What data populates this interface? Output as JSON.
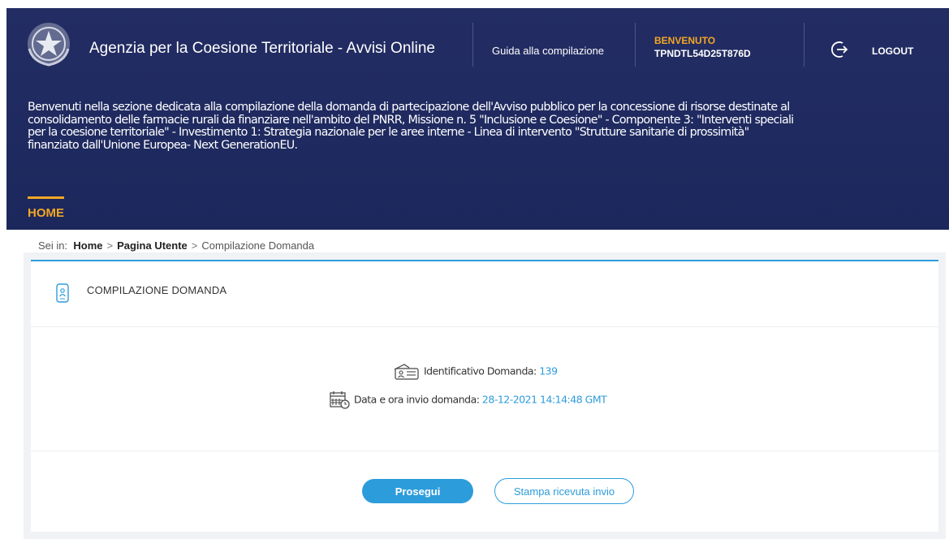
{
  "header": {
    "app_title": "Agenzia per la Coesione Territoriale - Avvisi Online",
    "guide_link": "Guida alla compilazione",
    "welcome_label": "BENVENUTO",
    "user_code": "TPNDTL54D25T876D",
    "logout_label": "LOGOUT"
  },
  "intro": {
    "lines": [
      "Benvenuti nella sezione dedicata alla compilazione della domanda di partecipazione dell'Avviso pubblico per la concessione di risorse destinate al",
      "consolidamento delle farmacie rurali da finanziare nell'ambito del PNRR, Missione n. 5 \"Inclusione e Coesione\" - Componente 3: \"Interventi speciali",
      "per la coesione territoriale\" - Investimento 1: Strategia nazionale per le aree interne - Linea di intervento \"Strutture sanitarie di prossimità\"",
      "finanziato dall'Unione Europea- Next GenerationEU."
    ]
  },
  "nav": {
    "home_tab": "HOME"
  },
  "breadcrumb": {
    "prefix": "Sei in:",
    "items": [
      "Home",
      "Pagina Utente",
      "Compilazione Domanda"
    ],
    "separator": ">"
  },
  "panel": {
    "title": "COMPILAZIONE DOMANDA",
    "id_label": "Identificativo Domanda:",
    "id_value": "139",
    "date_label": "Data e ora invio domanda:",
    "date_value": "28-12-2021 14:14:48 GMT"
  },
  "actions": {
    "continue_label": "Prosegui",
    "print_label": "Stampa ricevuta invio"
  },
  "colors": {
    "header_bg": "#1f2a60",
    "accent": "#f5a623",
    "primary": "#2d9cdb"
  }
}
